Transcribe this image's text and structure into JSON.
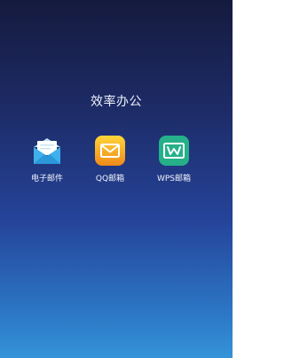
{
  "folder": {
    "title": "效率办公"
  },
  "apps": [
    {
      "label": "电子邮件",
      "icon": "email-envelope-icon",
      "color": "#39a9e6"
    },
    {
      "label": "QQ邮箱",
      "icon": "qq-mail-icon",
      "color": "#f2a31e"
    },
    {
      "label": "WPS邮箱",
      "icon": "wps-mail-icon",
      "color": "#27b28a"
    }
  ]
}
